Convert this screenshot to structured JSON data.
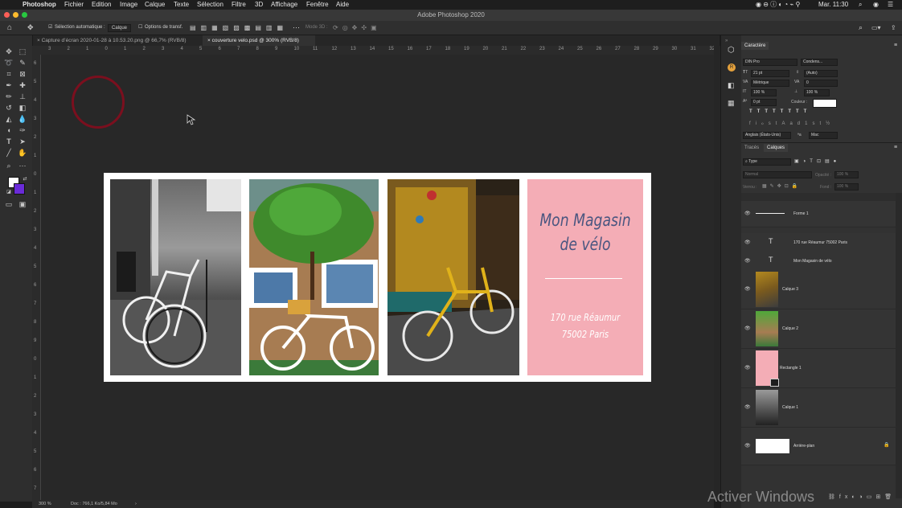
{
  "menubar": {
    "app": "Photoshop",
    "menus": [
      "Fichier",
      "Edition",
      "Image",
      "Calque",
      "Texte",
      "Sélection",
      "Filtre",
      "3D",
      "Affichage",
      "Fenêtre",
      "Aide"
    ],
    "clock": "Mar. 11:30"
  },
  "window": {
    "title": "Adobe Photoshop 2020"
  },
  "options_bar": {
    "auto_select_label": "Sélection automatique :",
    "auto_select_value": "Calque",
    "transform_label": "Options de transf.",
    "mode3d_label": "Mode 3D :"
  },
  "tabs": [
    {
      "label": "Capture d’écran 2020-01-28 à 10.53.20.png @ 66,7% (RVB/8)",
      "active": false
    },
    {
      "label": "couverture velo.psd @ 300% (RVB/8)",
      "active": true
    }
  ],
  "rulers": {
    "top": [
      "3",
      "2",
      "1",
      "0",
      "1",
      "2",
      "3",
      "4",
      "5",
      "6",
      "7",
      "8",
      "9",
      "10",
      "11",
      "12",
      "13",
      "14",
      "15",
      "16",
      "17",
      "18",
      "19",
      "20",
      "21",
      "22",
      "23",
      "24",
      "25",
      "26",
      "27",
      "28",
      "29",
      "30",
      "31",
      "32",
      "33"
    ],
    "left": [
      "6",
      "5",
      "4",
      "3",
      "2",
      "1",
      "0",
      "1",
      "2",
      "3",
      "4",
      "5",
      "6",
      "7",
      "8",
      "9",
      "0",
      "1",
      "2",
      "3",
      "4",
      "5",
      "6",
      "7"
    ]
  },
  "artwork": {
    "title_line1": "Mon Magasin",
    "title_line2": "de vélo",
    "address_line1": "170 rue Réaumur",
    "address_line2": "75002 Paris",
    "accent_pink": "#f4adb6",
    "text_blue": "#4a5680"
  },
  "status": {
    "zoom": "300 %",
    "doc": "Doc : 766,1 Ko/5,84 Mo"
  },
  "character_panel": {
    "title": "Caractère",
    "font_family": "DIN Pro",
    "font_style": "Condens...",
    "size": "21 pt",
    "leading": "(Auto)",
    "kerning": "Métrique",
    "tracking": "0",
    "vscale": "100 %",
    "hscale": "100 %",
    "baseline": "0 pt",
    "color_label": "Couleur :",
    "language": "Anglais (États-Unis)",
    "antialias": "Mac"
  },
  "layers_panel": {
    "tabs": [
      "Tracés",
      "Calques"
    ],
    "filter": "Type",
    "blend": "Normal",
    "opacity_label": "Opacité :",
    "opacity": "100 %",
    "lock_label": "Verrou :",
    "fill_label": "Fond :",
    "fill": "100 %",
    "layers": [
      {
        "name": "Forme 1",
        "kind": "shape"
      },
      {
        "name": "170 rue Réaumur 75002 Paris",
        "kind": "text"
      },
      {
        "name": "Mon Magasin de vélo",
        "kind": "text"
      },
      {
        "name": "Calque 3",
        "kind": "photo"
      },
      {
        "name": "Calque 2",
        "kind": "photo"
      },
      {
        "name": "Rectangle 1",
        "kind": "pink"
      },
      {
        "name": "Calque 1",
        "kind": "photo"
      },
      {
        "name": "Arrière-plan",
        "kind": "background"
      }
    ]
  },
  "watermark": "Activer Windows"
}
